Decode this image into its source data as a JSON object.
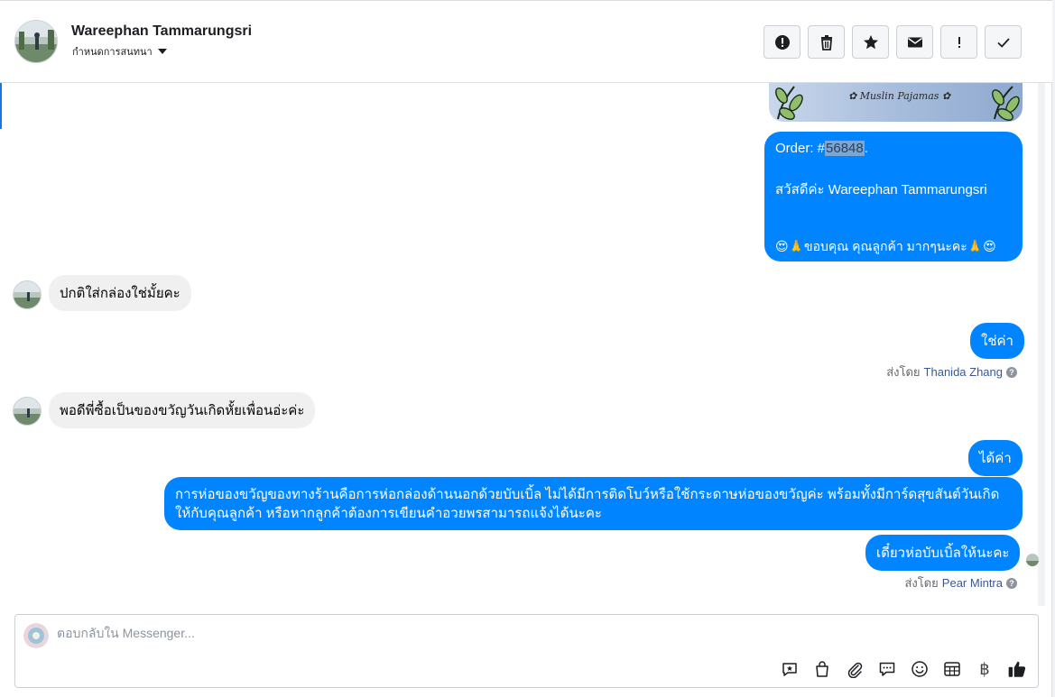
{
  "header": {
    "name": "Wareephan Tammarungsri",
    "assign_label": "กำหนดการสนทนา",
    "tools": [
      "spam",
      "delete",
      "star",
      "unread",
      "important",
      "done"
    ]
  },
  "banner": {
    "text": "✿ Muslin Pajamas ✿"
  },
  "order": {
    "prefix": "Order: #",
    "number": "56848",
    "suffix": ".",
    "greeting": "สวัสดีค่ะ Wareephan Tammarungsri",
    "thanks": "😍🙏ขอบคุณ คุณลูกค้า มากๆนะคะ🙏😍"
  },
  "messages": {
    "in1": "ปกติใส่กล่องใช่มั้ยคะ",
    "out1": "ใช่ค่า",
    "in2": "พอดีพี่ซื้อเป็นของขวัญวันเกิดหั้ยเพื่อนอ่ะค่ะ",
    "out2": "ได้ค่า",
    "out3_line1": "การห่อของขวัญของทางร้านคือการห่อกล่องด้านนอกด้วยบับเบิ้ล ไม่ได้มีการติดโบว์หรือใช้กระดาษห่อของขวัญค่ะ พร้อมทั้งมีการ์ดสุขสันต์วันเกิด",
    "out3_line2": "ให้กับคุณลูกค้า หรือหากลูกค้าต้องการเขียนคำอวยพรสามารถแจ้งได้นะคะ",
    "out4": "เดี๋ยวห่อบับเบิ้ลให้นะคะ"
  },
  "sent_by": {
    "label": "ส่งโดย",
    "agent1": "Thanida Zhang",
    "agent2": "Pear Mintra"
  },
  "composer": {
    "placeholder": "ตอบกลับใน Messenger...",
    "baht": "฿"
  }
}
